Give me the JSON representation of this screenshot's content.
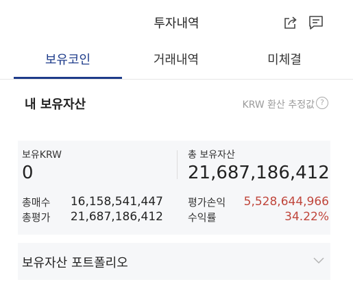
{
  "header": {
    "title": "투자내역",
    "share_icon": "share-icon",
    "chat_icon": "chat-icon"
  },
  "tabs": [
    {
      "label": "보유코인",
      "active": true
    },
    {
      "label": "거래내역",
      "active": false
    },
    {
      "label": "미체결",
      "active": false
    }
  ],
  "section": {
    "title": "내 보유자산",
    "note": "KRW 환산 추정값",
    "help_symbol": "?"
  },
  "summary": {
    "krw_label": "보유KRW",
    "krw_value": "0",
    "total_label": "총 보유자산",
    "total_value": "21,687,186,412",
    "buy_label": "총매수",
    "buy_value": "16,158,541,447",
    "eval_label": "총평가",
    "eval_value": "21,687,186,412",
    "pl_label": "평가손익",
    "pl_value": "5,528,644,966",
    "rate_label": "수익률",
    "rate_value": "34.22%"
  },
  "portfolio": {
    "label": "보유자산 포트폴리오"
  },
  "colors": {
    "accent": "#1d3b8a",
    "positive": "#c0463c",
    "panel": "#f6f7f9"
  }
}
